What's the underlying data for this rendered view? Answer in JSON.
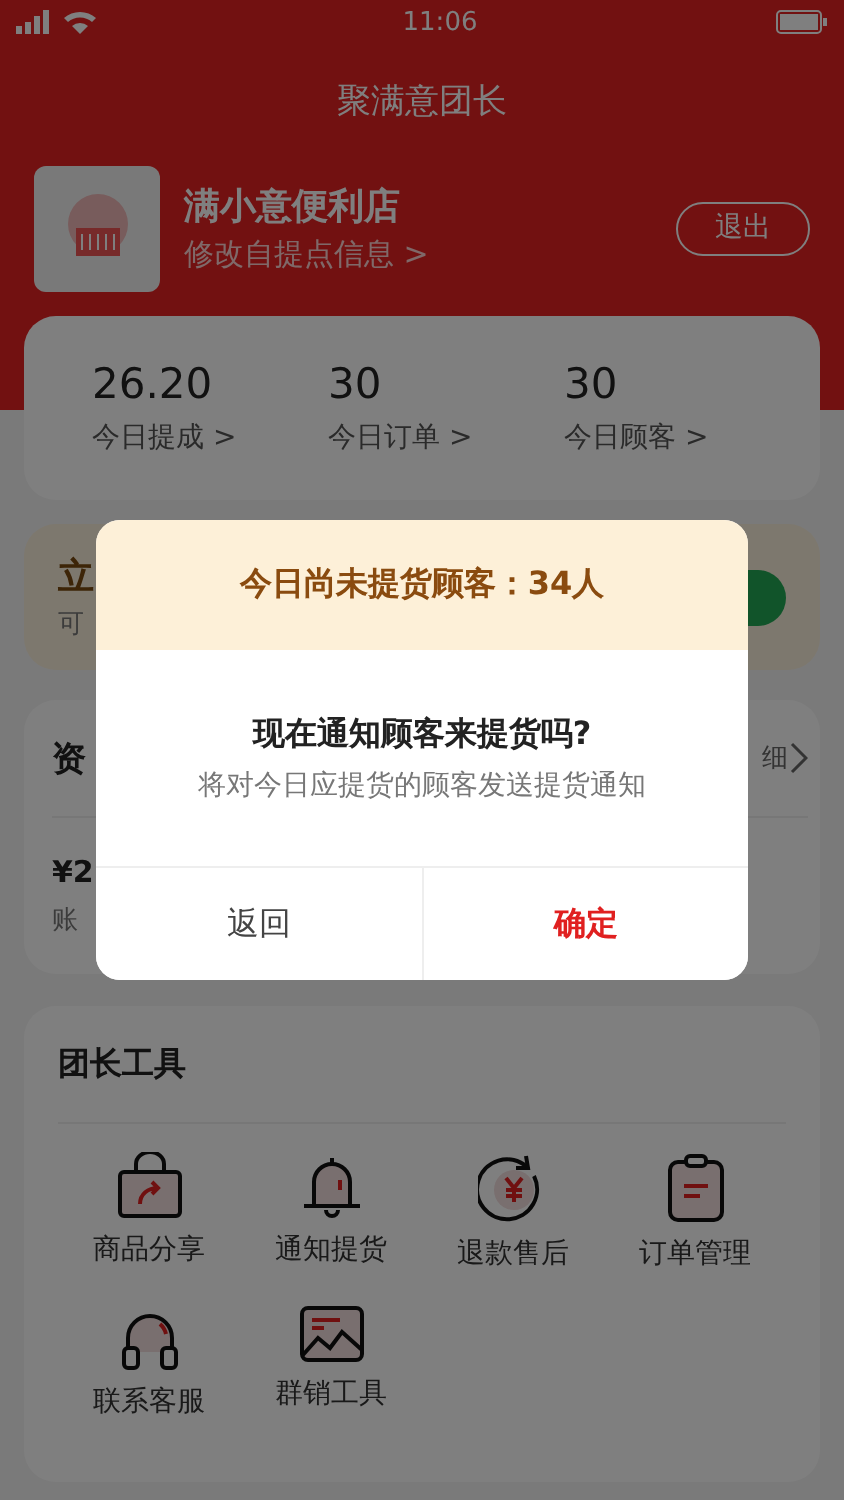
{
  "status_bar": {
    "time": "11:06"
  },
  "header": {
    "title": "聚满意团长"
  },
  "store": {
    "name": "满小意便利店",
    "edit_link": "修改自提点信息 >",
    "logout_button": "退出"
  },
  "stats": [
    {
      "value": "26.20",
      "label": "今日提成 >"
    },
    {
      "value": "30",
      "label": "今日订单 >"
    },
    {
      "value": "30",
      "label": "今日顾客 >"
    }
  ],
  "banner": {
    "title": "立",
    "subtitle": "可"
  },
  "funds": {
    "title": "资",
    "detail_link": "细",
    "amount": "¥2",
    "amount_label": "账"
  },
  "tools": {
    "title": "团长工具",
    "items": [
      {
        "label": "商品分享",
        "kind": "bag"
      },
      {
        "label": "通知提货",
        "kind": "bell"
      },
      {
        "label": "退款售后",
        "kind": "refund"
      },
      {
        "label": "订单管理",
        "kind": "clipboard"
      },
      {
        "label": "联系客服",
        "kind": "headset"
      },
      {
        "label": "群销工具",
        "kind": "image"
      }
    ]
  },
  "dialog": {
    "header": "今日尚未提货顾客：34人",
    "question": "现在通知顾客来提货吗?",
    "message": "将对今日应提货的顾客发送提货通知",
    "buttons": [
      {
        "label": "返回",
        "kind": "cancel"
      },
      {
        "label": "确定",
        "kind": "confirm"
      }
    ]
  }
}
